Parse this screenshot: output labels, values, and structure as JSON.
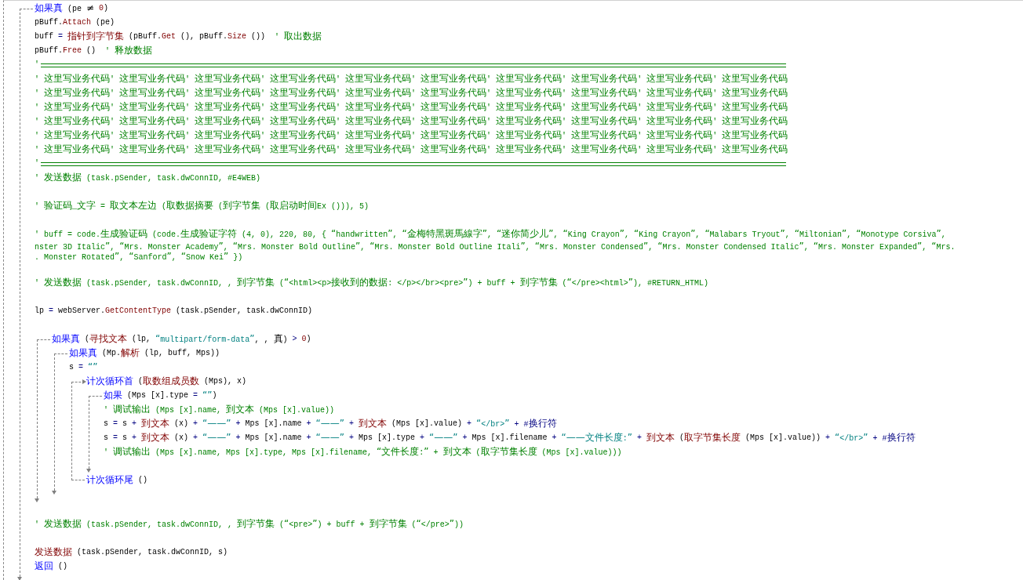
{
  "editor": {
    "lines": [
      {
        "kind": "if",
        "header": [
          {
            "kind": "kw",
            "text": "如果真"
          },
          {
            "kind": "txt",
            "text": " (pe ≠ "
          },
          {
            "kind": "fn",
            "text": "0"
          },
          {
            "kind": "txt",
            "text": ")"
          }
        ],
        "children": [
          {
            "kind": "code",
            "tokens": [
              {
                "kind": "txt",
                "text": "pBuff."
              },
              {
                "kind": "fn",
                "text": "Attach"
              },
              {
                "kind": "txt",
                "text": " (pe)"
              }
            ]
          },
          {
            "kind": "code",
            "tokens": [
              {
                "kind": "txt",
                "text": "buff "
              },
              {
                "kind": "op",
                "text": "= "
              },
              {
                "kind": "fn",
                "text": "指针到字节集"
              },
              {
                "kind": "txt",
                "text": " (pBuff."
              },
              {
                "kind": "fn",
                "text": "Get"
              },
              {
                "kind": "txt",
                "text": " (), pBuff."
              },
              {
                "kind": "fn",
                "text": "Size"
              },
              {
                "kind": "txt",
                "text": " ())  "
              },
              {
                "kind": "cmt",
                "text": "' 取出数据"
              }
            ]
          },
          {
            "kind": "code",
            "tokens": [
              {
                "kind": "txt",
                "text": "pBuff."
              },
              {
                "kind": "fn",
                "text": "Free"
              },
              {
                "kind": "txt",
                "text": " ()  "
              },
              {
                "kind": "cmt",
                "text": "' 释放数据"
              }
            ]
          },
          {
            "kind": "rule",
            "text": "'"
          },
          {
            "kind": "code",
            "tokens": [
              {
                "kind": "cmt",
                "text": "' 这里写业务代码' 这里写业务代码' 这里写业务代码' 这里写业务代码' 这里写业务代码' 这里写业务代码' 这里写业务代码' 这里写业务代码' 这里写业务代码' 这里写业务代码"
              }
            ]
          },
          {
            "kind": "code",
            "tokens": [
              {
                "kind": "cmt",
                "text": "' 这里写业务代码' 这里写业务代码' 这里写业务代码' 这里写业务代码' 这里写业务代码' 这里写业务代码' 这里写业务代码' 这里写业务代码' 这里写业务代码' 这里写业务代码"
              }
            ]
          },
          {
            "kind": "code",
            "tokens": [
              {
                "kind": "cmt",
                "text": "' 这里写业务代码' 这里写业务代码' 这里写业务代码' 这里写业务代码' 这里写业务代码' 这里写业务代码' 这里写业务代码' 这里写业务代码' 这里写业务代码' 这里写业务代码"
              }
            ]
          },
          {
            "kind": "code",
            "tokens": [
              {
                "kind": "cmt",
                "text": "' 这里写业务代码' 这里写业务代码' 这里写业务代码' 这里写业务代码' 这里写业务代码' 这里写业务代码' 这里写业务代码' 这里写业务代码' 这里写业务代码' 这里写业务代码"
              }
            ]
          },
          {
            "kind": "code",
            "tokens": [
              {
                "kind": "cmt",
                "text": "' 这里写业务代码' 这里写业务代码' 这里写业务代码' 这里写业务代码' 这里写业务代码' 这里写业务代码' 这里写业务代码' 这里写业务代码' 这里写业务代码' 这里写业务代码"
              }
            ]
          },
          {
            "kind": "code",
            "tokens": [
              {
                "kind": "cmt",
                "text": "' 这里写业务代码' 这里写业务代码' 这里写业务代码' 这里写业务代码' 这里写业务代码' 这里写业务代码' 这里写业务代码' 这里写业务代码' 这里写业务代码' 这里写业务代码"
              }
            ]
          },
          {
            "kind": "rule",
            "text": "'"
          },
          {
            "kind": "code",
            "tokens": [
              {
                "kind": "cmt",
                "text": "' 发送数据 (task.pSender, task.dwConnID, #E4WEB)"
              }
            ]
          },
          {
            "kind": "blank"
          },
          {
            "kind": "code",
            "tokens": [
              {
                "kind": "cmt",
                "text": "' 验证码_文字 = 取文本左边 (取数据摘要 (到字节集 (取启动时间Ex ())), 5)"
              }
            ]
          },
          {
            "kind": "blank"
          },
          {
            "kind": "code",
            "tokens": [
              {
                "kind": "cmt",
                "text": "' buff = code.生成验证码 (code.生成验证字符 (4, 0), 220, 80, { “handwritten”, “金梅特黑斑馬線字”, “迷你简少儿”, “King Crayon”, “King Crayon”, “Malabars Tryout”, “Miltonian”, “Monotype Corsiva”,"
              }
            ]
          },
          {
            "kind": "wrap",
            "tokens": [
              {
                "kind": "cmt",
                "text": "nster 3D Italic”, “Mrs. Monster Academy”, “Mrs. Monster Bold Outline”, “Mrs. Monster Bold Outline Itali”, “Mrs. Monster Condensed”, “Mrs. Monster Condensed Italic”, “Mrs. Monster Expanded”, “Mrs."
              }
            ]
          },
          {
            "kind": "wrap",
            "tokens": [
              {
                "kind": "cmt",
                "text": ". Monster Rotated”, “Sanford”, “Snow Kei” })"
              }
            ]
          },
          {
            "kind": "blank"
          },
          {
            "kind": "code",
            "tokens": [
              {
                "kind": "cmt",
                "text": "' 发送数据 (task.pSender, task.dwConnID, , 到字节集 (“<html><p>接收到的数据: </p></br><pre>”) + buff + 到字节集 (“</pre><html>”), #RETURN_HTML)"
              }
            ]
          },
          {
            "kind": "blank"
          },
          {
            "kind": "code",
            "tokens": [
              {
                "kind": "txt",
                "text": "lp "
              },
              {
                "kind": "op",
                "text": "= "
              },
              {
                "kind": "txt",
                "text": "webServer."
              },
              {
                "kind": "fn",
                "text": "GetContentType"
              },
              {
                "kind": "txt",
                "text": " (task.pSender, task.dwConnID)"
              }
            ]
          },
          {
            "kind": "blank"
          },
          {
            "kind": "if",
            "header": [
              {
                "kind": "kw",
                "text": "如果真"
              },
              {
                "kind": "txt",
                "text": " ("
              },
              {
                "kind": "fn",
                "text": "寻找文本"
              },
              {
                "kind": "txt",
                "text": " (lp, "
              },
              {
                "kind": "str",
                "text": "“multipart/form-data”"
              },
              {
                "kind": "txt",
                "text": ", , 真) "
              },
              {
                "kind": "op",
                "text": "> "
              },
              {
                "kind": "fn",
                "text": "0"
              },
              {
                "kind": "txt",
                "text": ")"
              }
            ],
            "children": [
              {
                "kind": "if",
                "header": [
                  {
                    "kind": "kw",
                    "text": "如果真"
                  },
                  {
                    "kind": "txt",
                    "text": " (Mp."
                  },
                  {
                    "kind": "fn",
                    "text": "解析"
                  },
                  {
                    "kind": "txt",
                    "text": " (lp, buff, Mps))"
                  }
                ],
                "children": [
                  {
                    "kind": "code",
                    "tokens": [
                      {
                        "kind": "txt",
                        "text": "s "
                      },
                      {
                        "kind": "op",
                        "text": "= "
                      },
                      {
                        "kind": "str",
                        "text": "“”"
                      }
                    ]
                  },
                  {
                    "kind": "loop",
                    "header": [
                      {
                        "kind": "kw",
                        "text": "计次循环首"
                      },
                      {
                        "kind": "txt",
                        "text": " ("
                      },
                      {
                        "kind": "fn",
                        "text": "取数组成员数"
                      },
                      {
                        "kind": "txt",
                        "text": " (Mps), x)"
                      }
                    ],
                    "footer": [
                      {
                        "kind": "kw",
                        "text": "计次循环尾"
                      },
                      {
                        "kind": "txt",
                        "text": " ()"
                      }
                    ],
                    "children": [
                      {
                        "kind": "ifelse",
                        "header": [
                          {
                            "kind": "kw",
                            "text": "如果"
                          },
                          {
                            "kind": "txt",
                            "text": " (Mps [x].type "
                          },
                          {
                            "kind": "op",
                            "text": "= "
                          },
                          {
                            "kind": "str",
                            "text": "“”"
                          },
                          {
                            "kind": "txt",
                            "text": ")"
                          }
                        ],
                        "children": [
                          {
                            "kind": "code",
                            "tokens": [
                              {
                                "kind": "cmt",
                                "text": "' 调试输出 (Mps [x].name, 到文本 (Mps [x].value))"
                              }
                            ]
                          },
                          {
                            "kind": "code",
                            "tokens": [
                              {
                                "kind": "txt",
                                "text": "s "
                              },
                              {
                                "kind": "op",
                                "text": "= "
                              },
                              {
                                "kind": "txt",
                                "text": "s "
                              },
                              {
                                "kind": "op",
                                "text": "+ "
                              },
                              {
                                "kind": "fn",
                                "text": "到文本"
                              },
                              {
                                "kind": "txt",
                                "text": " (x) "
                              },
                              {
                                "kind": "op",
                                "text": "+ "
                              },
                              {
                                "kind": "str",
                                "text": "“——”"
                              },
                              {
                                "kind": "op",
                                "text": " + "
                              },
                              {
                                "kind": "txt",
                                "text": "Mps [x].name "
                              },
                              {
                                "kind": "op",
                                "text": "+ "
                              },
                              {
                                "kind": "str",
                                "text": "“——”"
                              },
                              {
                                "kind": "op",
                                "text": " + "
                              },
                              {
                                "kind": "fn",
                                "text": "到文本"
                              },
                              {
                                "kind": "txt",
                                "text": " (Mps [x].value) "
                              },
                              {
                                "kind": "op",
                                "text": "+ "
                              },
                              {
                                "kind": "str",
                                "text": "“</br>”"
                              },
                              {
                                "kind": "op",
                                "text": " + #换行符"
                              }
                            ]
                          }
                        ],
                        "else": [
                          {
                            "kind": "code",
                            "tokens": [
                              {
                                "kind": "txt",
                                "text": "s "
                              },
                              {
                                "kind": "op",
                                "text": "= "
                              },
                              {
                                "kind": "txt",
                                "text": "s "
                              },
                              {
                                "kind": "op",
                                "text": "+ "
                              },
                              {
                                "kind": "fn",
                                "text": "到文本"
                              },
                              {
                                "kind": "txt",
                                "text": " (x) "
                              },
                              {
                                "kind": "op",
                                "text": "+ "
                              },
                              {
                                "kind": "str",
                                "text": "“——”"
                              },
                              {
                                "kind": "op",
                                "text": " + "
                              },
                              {
                                "kind": "txt",
                                "text": "Mps [x].name "
                              },
                              {
                                "kind": "op",
                                "text": "+ "
                              },
                              {
                                "kind": "str",
                                "text": "“——”"
                              },
                              {
                                "kind": "op",
                                "text": " + "
                              },
                              {
                                "kind": "txt",
                                "text": "Mps [x].type "
                              },
                              {
                                "kind": "op",
                                "text": "+ "
                              },
                              {
                                "kind": "str",
                                "text": "“——”"
                              },
                              {
                                "kind": "op",
                                "text": " + "
                              },
                              {
                                "kind": "txt",
                                "text": "Mps [x].filename "
                              },
                              {
                                "kind": "op",
                                "text": "+ "
                              },
                              {
                                "kind": "str",
                                "text": "“——文件长度:”"
                              },
                              {
                                "kind": "op",
                                "text": " + "
                              },
                              {
                                "kind": "fn",
                                "text": "到文本"
                              },
                              {
                                "kind": "txt",
                                "text": " ("
                              },
                              {
                                "kind": "fn",
                                "text": "取字节集长度"
                              },
                              {
                                "kind": "txt",
                                "text": " (Mps [x].value)) "
                              },
                              {
                                "kind": "op",
                                "text": "+ "
                              },
                              {
                                "kind": "str",
                                "text": "“</br>”"
                              },
                              {
                                "kind": "op",
                                "text": " + #换行符"
                              }
                            ]
                          },
                          {
                            "kind": "code",
                            "tokens": [
                              {
                                "kind": "cmt",
                                "text": "' 调试输出 (Mps [x].name, Mps [x].type, Mps [x].filename, “文件长度:” + 到文本 (取字节集长度 (Mps [x].value)))"
                              }
                            ]
                          }
                        ]
                      }
                    ]
                  }
                ]
              }
            ]
          },
          {
            "kind": "blank"
          },
          {
            "kind": "code",
            "tokens": [
              {
                "kind": "cmt",
                "text": "' 发送数据 (task.pSender, task.dwConnID, , 到字节集 (“<pre>”) + buff + 到字节集 (“</pre>”))"
              }
            ]
          },
          {
            "kind": "blank"
          },
          {
            "kind": "code",
            "tokens": [
              {
                "kind": "fn",
                "text": "发送数据"
              },
              {
                "kind": "txt",
                "text": " (task.pSender, task.dwConnID, s)"
              }
            ]
          },
          {
            "kind": "code",
            "tokens": [
              {
                "kind": "kw",
                "text": "返回"
              },
              {
                "kind": "txt",
                "text": " ()"
              }
            ]
          }
        ]
      }
    ]
  }
}
